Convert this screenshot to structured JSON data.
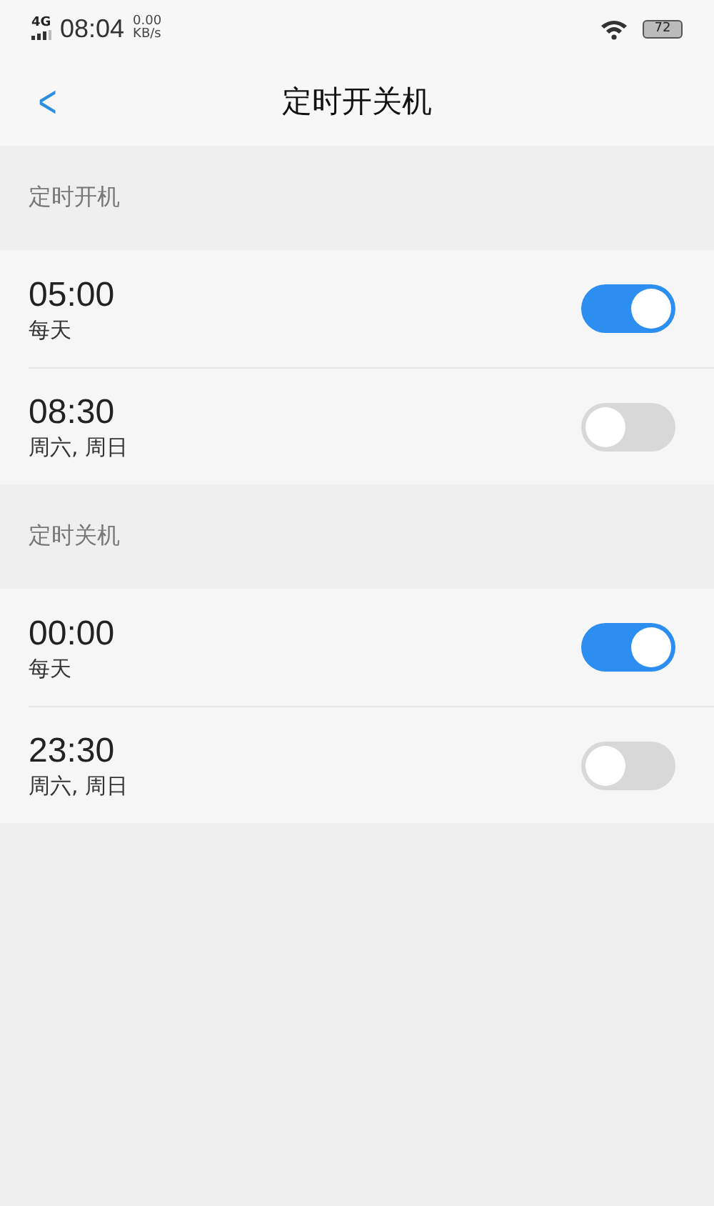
{
  "status_bar": {
    "network": "4G",
    "time": "08:04",
    "speed_value": "0.00",
    "speed_unit": "KB/s",
    "battery": "72"
  },
  "header": {
    "back": "<",
    "title": "定时开关机"
  },
  "sections": [
    {
      "title": "定时开机",
      "items": [
        {
          "time": "05:00",
          "repeat": "每天",
          "on": true
        },
        {
          "time": "08:30",
          "repeat": "周六, 周日",
          "on": false
        }
      ]
    },
    {
      "title": "定时关机",
      "items": [
        {
          "time": "00:00",
          "repeat": "每天",
          "on": true
        },
        {
          "time": "23:30",
          "repeat": "周六, 周日",
          "on": false
        }
      ]
    }
  ]
}
